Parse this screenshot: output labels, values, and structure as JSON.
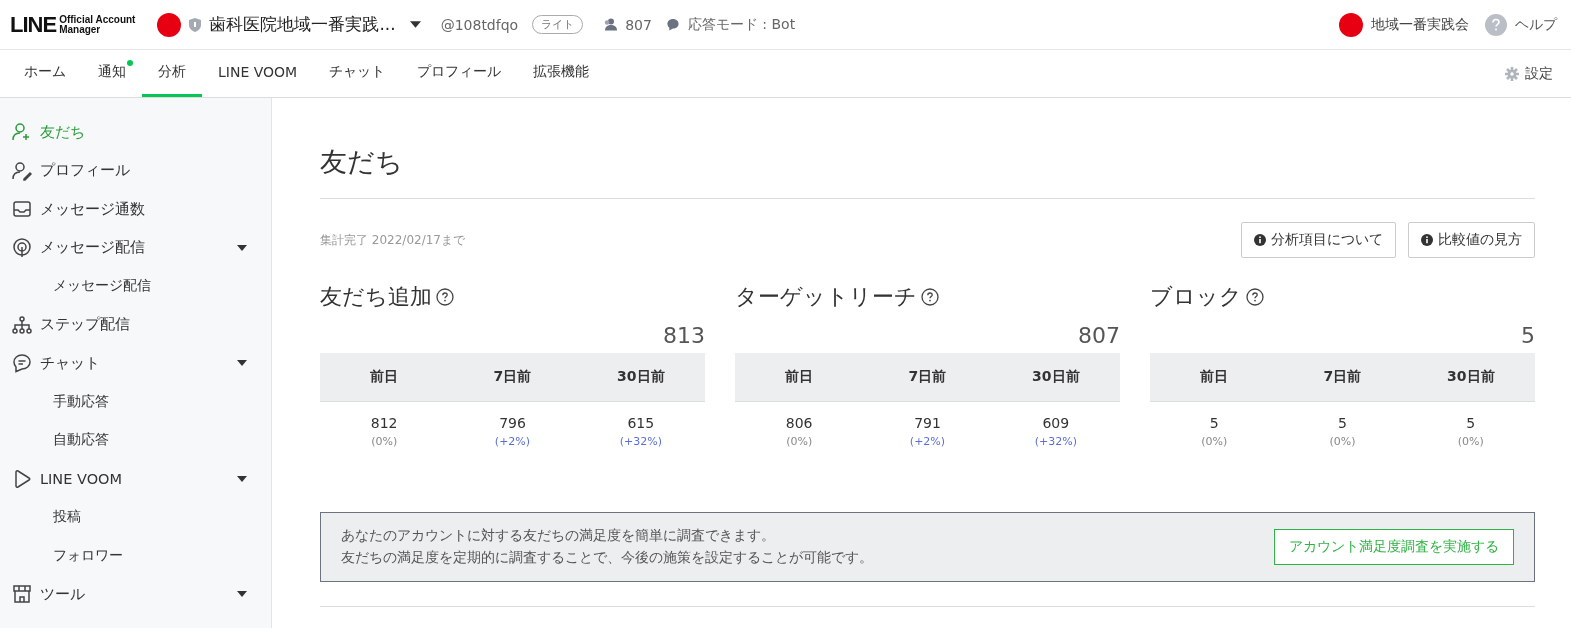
{
  "header": {
    "logo_main": "LINE",
    "logo_sub": [
      "Official Account",
      "Manager"
    ],
    "account_name": "歯科医院地域一番実践...",
    "account_id": "@108tdfqo",
    "plan_badge": "ライト",
    "friends_count": "807",
    "response_mode": "応答モード : Bot",
    "user_name": "地域一番実践会",
    "help": "ヘルプ"
  },
  "tabs": [
    {
      "label": "ホーム",
      "selected": false,
      "notify": false
    },
    {
      "label": "通知",
      "selected": false,
      "notify": true
    },
    {
      "label": "分析",
      "selected": true,
      "notify": false
    },
    {
      "label": "LINE VOOM",
      "selected": false,
      "notify": false
    },
    {
      "label": "チャット",
      "selected": false,
      "notify": false
    },
    {
      "label": "プロフィール",
      "selected": false,
      "notify": false
    },
    {
      "label": "拡張機能",
      "selected": false,
      "notify": false
    }
  ],
  "settings": "設定",
  "sidebar": {
    "items": [
      {
        "label": "友だち",
        "kind": "person-add",
        "selected": true
      },
      {
        "label": "プロフィール",
        "kind": "person-edit",
        "selected": false
      },
      {
        "label": "メッセージ通数",
        "kind": "tray",
        "selected": false
      },
      {
        "label": "メッセージ配信",
        "kind": "broadcast",
        "selected": false,
        "expanded": true,
        "children": [
          {
            "label": "メッセージ配信",
            "selected": false
          }
        ]
      },
      {
        "label": "ステップ配信",
        "kind": "tree",
        "selected": false
      },
      {
        "label": "チャット",
        "kind": "chat",
        "selected": false,
        "expanded": true,
        "children": [
          {
            "label": "手動応答",
            "selected": false
          },
          {
            "label": "自動応答",
            "selected": false
          }
        ]
      },
      {
        "label": "LINE VOOM",
        "kind": "play",
        "selected": false,
        "expanded": true,
        "children": [
          {
            "label": "投稿",
            "selected": false
          },
          {
            "label": "フォロワー",
            "selected": false
          }
        ]
      },
      {
        "label": "ツール",
        "kind": "shop",
        "selected": false,
        "expanded": true
      }
    ]
  },
  "page": {
    "title": "友だち",
    "updated": "集計完了 2022/02/17まで",
    "buttons": [
      "分析項目について",
      "比較値の見方"
    ],
    "metrics": [
      {
        "title": "友だち追加",
        "total": "813",
        "columns": [
          {
            "header": "前日",
            "value": "812",
            "change": "(0%)",
            "kind": "flat"
          },
          {
            "header": "7日前",
            "value": "796",
            "change": "(+2%)",
            "kind": "up"
          },
          {
            "header": "30日前",
            "value": "615",
            "change": "(+32%)",
            "kind": "up"
          }
        ]
      },
      {
        "title": "ターゲットリーチ",
        "total": "807",
        "columns": [
          {
            "header": "前日",
            "value": "806",
            "change": "(0%)",
            "kind": "flat"
          },
          {
            "header": "7日前",
            "value": "791",
            "change": "(+2%)",
            "kind": "up"
          },
          {
            "header": "30日前",
            "value": "609",
            "change": "(+32%)",
            "kind": "up"
          }
        ]
      },
      {
        "title": "ブロック",
        "total": "5",
        "columns": [
          {
            "header": "前日",
            "value": "5",
            "change": "(0%)",
            "kind": "flat"
          },
          {
            "header": "7日前",
            "value": "5",
            "change": "(0%)",
            "kind": "flat"
          },
          {
            "header": "30日前",
            "value": "5",
            "change": "(0%)",
            "kind": "flat"
          }
        ]
      }
    ],
    "survey": {
      "lines": [
        "あなたのアカウントに対する友だちの満足度を簡単に調査できます。",
        "友だちの満足度を定期的に調査することで、今後の施策を設定することが可能です。"
      ],
      "button": "アカウント満足度調査を実施する"
    }
  }
}
